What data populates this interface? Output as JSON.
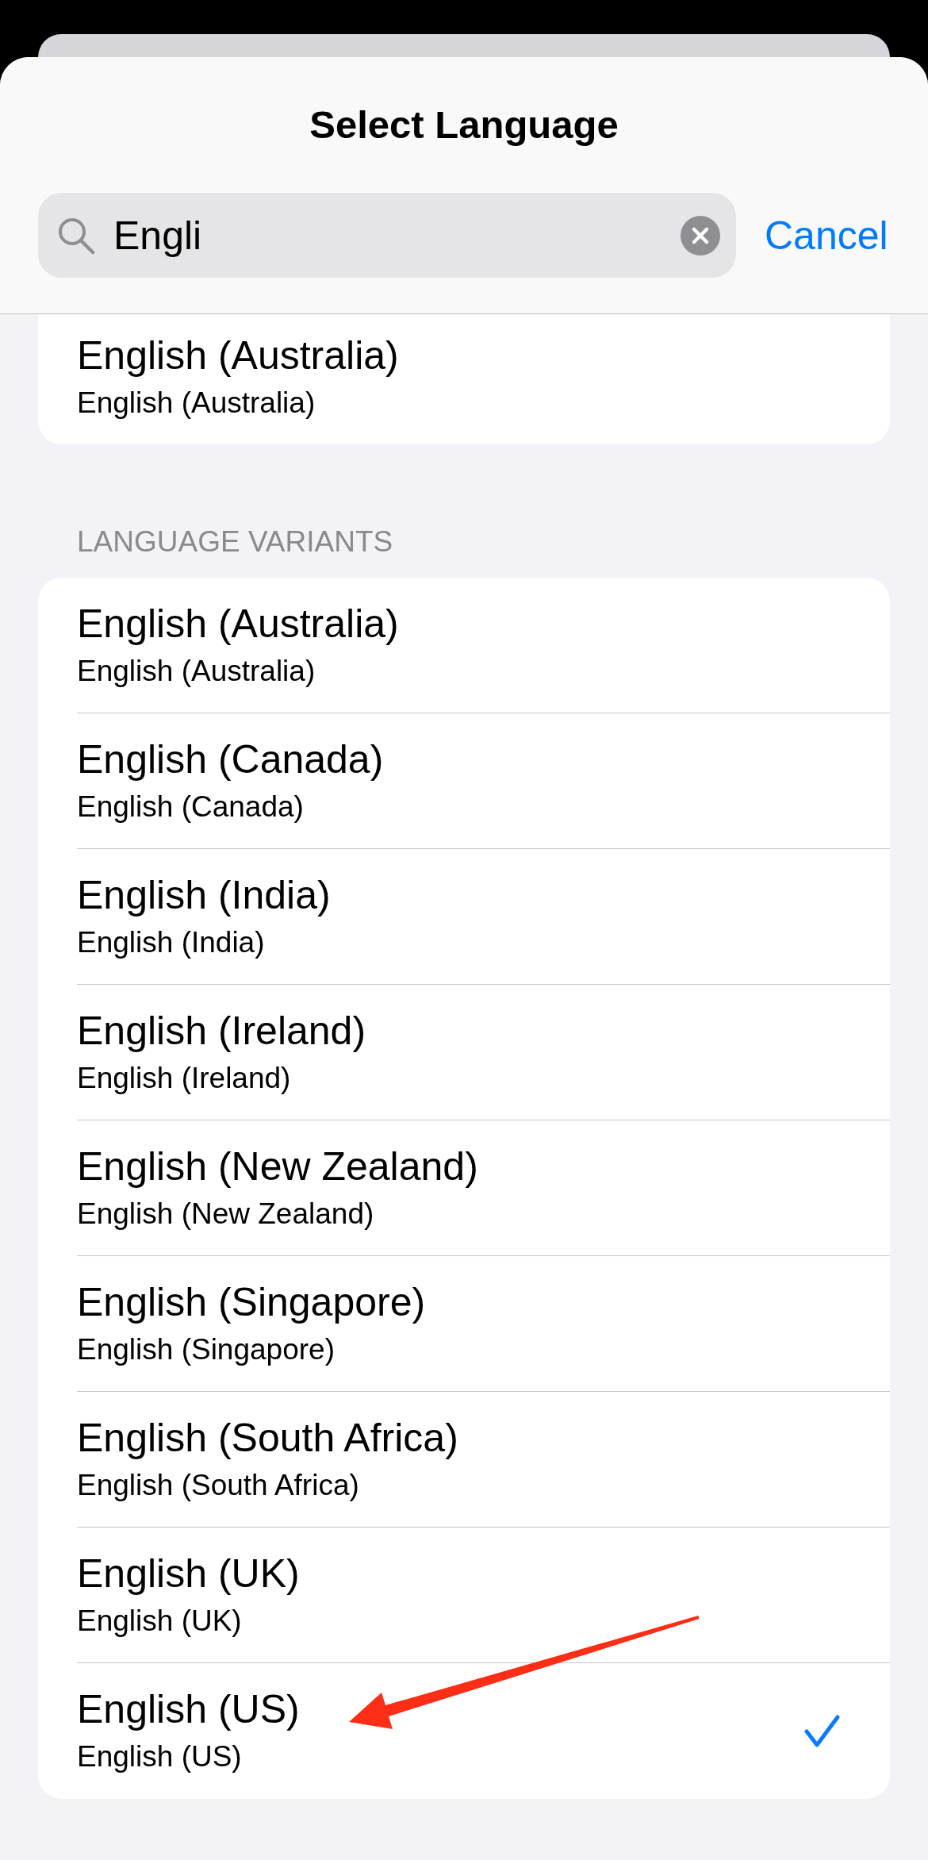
{
  "title": "Select Language",
  "search": {
    "value": "Engli",
    "cancel": "Cancel"
  },
  "top_section": {
    "items": [
      {
        "title": "English (Australia)",
        "subtitle": "English (Australia)",
        "selected": false
      }
    ]
  },
  "variants_section": {
    "header": "LANGUAGE VARIANTS",
    "items": [
      {
        "title": "English (Australia)",
        "subtitle": "English (Australia)",
        "selected": false
      },
      {
        "title": "English (Canada)",
        "subtitle": "English (Canada)",
        "selected": false
      },
      {
        "title": "English (India)",
        "subtitle": "English (India)",
        "selected": false
      },
      {
        "title": "English (Ireland)",
        "subtitle": "English (Ireland)",
        "selected": false
      },
      {
        "title": "English (New Zealand)",
        "subtitle": "English (New Zealand)",
        "selected": false
      },
      {
        "title": "English (Singapore)",
        "subtitle": "English (Singapore)",
        "selected": false
      },
      {
        "title": "English (South Africa)",
        "subtitle": "English (South Africa)",
        "selected": false
      },
      {
        "title": "English (UK)",
        "subtitle": "English (UK)",
        "selected": false
      },
      {
        "title": "English (US)",
        "subtitle": "English (US)",
        "selected": true
      }
    ]
  }
}
